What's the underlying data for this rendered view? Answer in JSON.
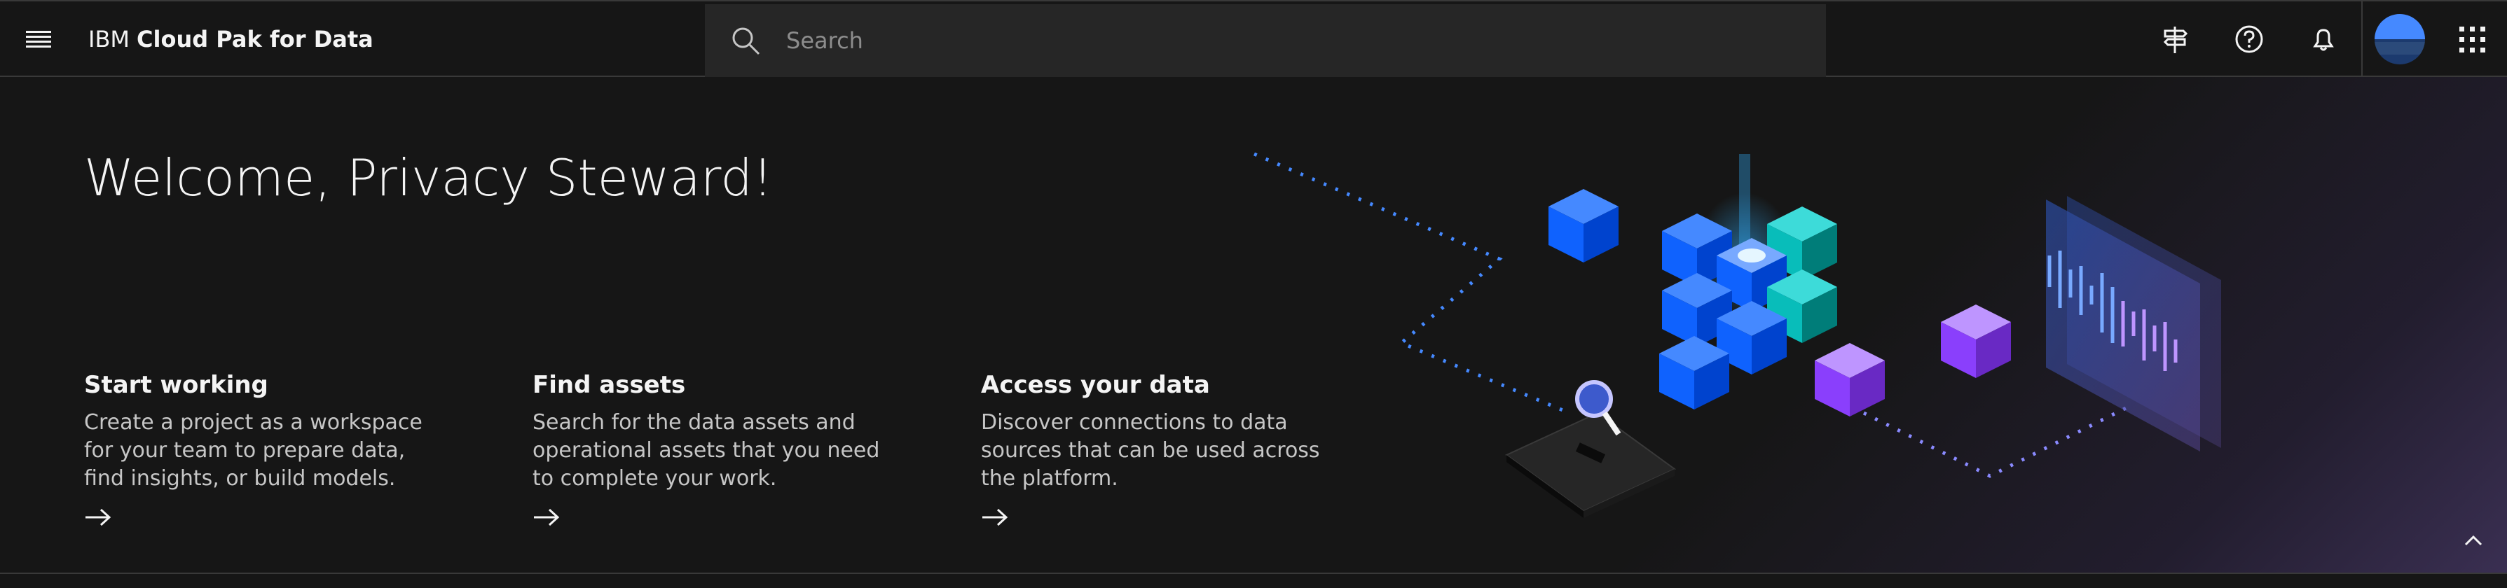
{
  "header": {
    "brand_prefix": "IBM",
    "brand_name": "Cloud Pak for Data",
    "search_placeholder": "Search",
    "icons": [
      "menu-icon",
      "search-icon",
      "signpost-icon",
      "help-icon",
      "notification-icon",
      "avatar",
      "app-switcher-icon"
    ]
  },
  "main": {
    "welcome": "Welcome, Privacy Steward!",
    "cards": [
      {
        "title": "Start working",
        "description": "Create a project as a workspace for your team to prepare data, find insights, or build models."
      },
      {
        "title": "Find assets",
        "description": "Search for the data assets and operational assets that you need to complete your work."
      },
      {
        "title": "Access your data",
        "description": "Discover connections to data sources that can be used across the platform."
      }
    ]
  },
  "colors": {
    "background": "#161616",
    "search_bg": "#262626",
    "accent_blue": "#0f62fe",
    "accent_teal": "#08bdba",
    "accent_purple": "#a56eff"
  }
}
